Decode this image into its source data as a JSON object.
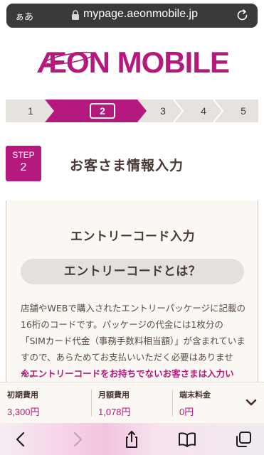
{
  "browser": {
    "text_size_label": "ぁあ",
    "url": "mypage.aeonmobile.jp"
  },
  "brand": {
    "logo_text": "ÆON MOBILE",
    "color": "#b5197e"
  },
  "stepper": {
    "steps": [
      "1",
      "2",
      "3",
      "4",
      "5"
    ],
    "current": "2"
  },
  "step_header": {
    "badge_label": "STEP",
    "badge_number": "2",
    "title": "お客さま情報入力"
  },
  "entry_card": {
    "title": "エントリーコード入力",
    "faq_pill": "エントリーコードとは？",
    "description": "店舗やWEBで購入されたエントリーパッケージに記載の16桁のコードです。パッケージの代金には1枚分の「SIMカード代金（事務手数料相当額）」が含まれていますので、あらためてお支払いいただく必要はありません。",
    "warning": "※エントリーコードをお持ちでないお客さまは入力い"
  },
  "fees": {
    "initial_label": "初期費用",
    "initial_value": "3,300円",
    "monthly_label": "月額費用",
    "monthly_value": "1,078円",
    "device_label": "端末料金",
    "device_value": "0円"
  },
  "icons": {
    "lock": "lock-icon",
    "reload": "reload-icon",
    "expand": "chevron-down-icon",
    "back": "back-icon",
    "forward": "forward-icon",
    "share": "share-icon",
    "bookmarks": "bookmarks-icon",
    "tabs": "tabs-icon"
  }
}
